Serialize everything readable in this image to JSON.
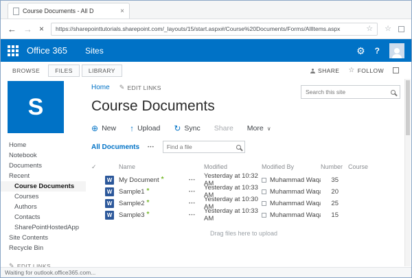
{
  "browser": {
    "tab_title": "Course Documents - All D",
    "url": "https://sharepointtutorials.sharepoint.com/_layouts/15/start.aspx#/Course%20Documents/Forms/AllItems.aspx",
    "status_text": "Waiting for outlook.office365.com..."
  },
  "suite_bar": {
    "brand": "Office 365",
    "section": "Sites"
  },
  "ribbon": {
    "tabs": {
      "browse": "BROWSE",
      "files": "FILES",
      "library": "LIBRARY"
    },
    "share": "SHARE",
    "follow": "FOLLOW"
  },
  "page": {
    "breadcrumb_home": "Home",
    "edit_links": "EDIT LINKS",
    "title": "Course Documents",
    "search_placeholder": "Search this site"
  },
  "toolbar": {
    "new": "New",
    "upload": "Upload",
    "sync": "Sync",
    "share": "Share",
    "more": "More"
  },
  "views": {
    "current": "All Documents",
    "find_placeholder": "Find a file"
  },
  "table": {
    "columns": [
      "Name",
      "Modified",
      "Modified By",
      "Number",
      "Course"
    ],
    "rows": [
      {
        "name": "My Document",
        "modified": "Yesterday at 10:32 AM",
        "modified_by": "Muhammad Waqas",
        "number": "35",
        "course": ""
      },
      {
        "name": "Sample1",
        "modified": "Yesterday at 10:33 AM",
        "modified_by": "Muhammad Waqas",
        "number": "20",
        "course": ""
      },
      {
        "name": "Sample2",
        "modified": "Yesterday at 10:30 AM",
        "modified_by": "Muhammad Waqas",
        "number": "25",
        "course": ""
      },
      {
        "name": "Sample3",
        "modified": "Yesterday at 10:33 AM",
        "modified_by": "Muhammad Waqas",
        "number": "15",
        "course": ""
      }
    ],
    "drag_hint": "Drag files here to upload"
  },
  "sidebar": {
    "logo_letter": "S",
    "items": [
      "Home",
      "Notebook",
      "Documents",
      "Recent",
      "Course Documents",
      "Courses",
      "Authors",
      "Contacts",
      "SharePointHostedApp",
      "Site Contents",
      "Recycle Bin"
    ],
    "edit_links": "EDIT LINKS"
  },
  "icons": {
    "back": "←",
    "forward": "→",
    "stop": "×",
    "close": "×",
    "star": "☆",
    "gear": "⚙",
    "help": "?",
    "pencil": "✎",
    "plus": "⊕",
    "upload": "↑",
    "sync": "↻",
    "chevron": "∨",
    "check": "✓",
    "ellipsis": "•••",
    "new_badge": "*",
    "word": "W"
  }
}
